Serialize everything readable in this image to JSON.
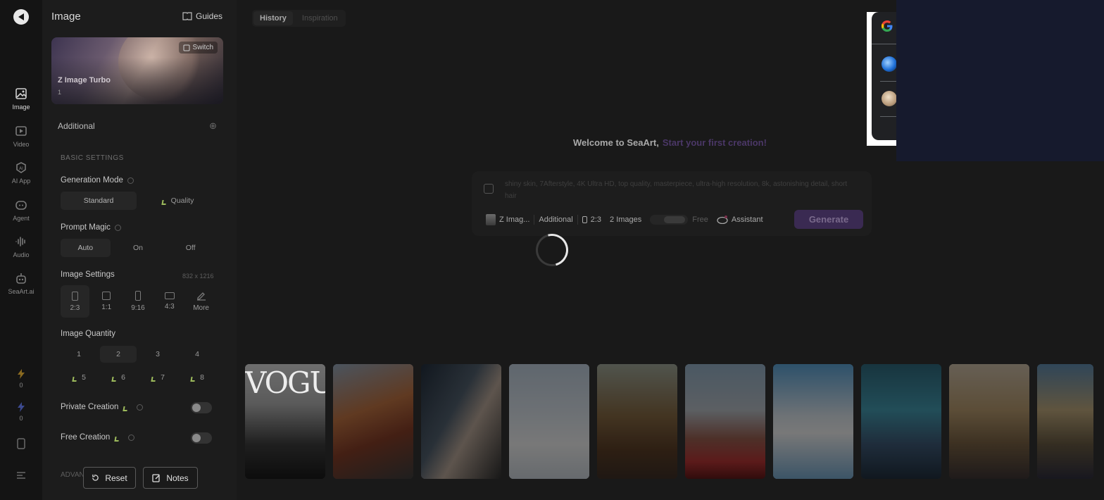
{
  "rail": {
    "items": [
      {
        "label": "Image",
        "icon": "image-icon"
      },
      {
        "label": "Video",
        "icon": "video-icon"
      },
      {
        "label": "AI App",
        "icon": "ai-app-icon"
      },
      {
        "label": "Agent",
        "icon": "agent-icon"
      },
      {
        "label": "Audio",
        "icon": "audio-icon"
      },
      {
        "label": "SeaArt.ai",
        "icon": "robot-icon"
      }
    ],
    "stats": [
      {
        "icon": "lightning-icon",
        "value": "0",
        "color": "#d4a72c"
      },
      {
        "icon": "lightning-icon",
        "value": "0",
        "color": "#5b6fd8"
      }
    ]
  },
  "panel": {
    "title": "Image",
    "guides_label": "Guides",
    "model": {
      "name": "Z Image Turbo",
      "sub": "1",
      "switch_label": "Switch"
    },
    "additional_label": "Additional",
    "basic_settings_label": "BASIC SETTINGS",
    "generation_mode": {
      "label": "Generation Mode",
      "options": [
        "Standard",
        "Quality"
      ],
      "selected": "Standard"
    },
    "prompt_magic": {
      "label": "Prompt Magic",
      "options": [
        "Auto",
        "On",
        "Off"
      ],
      "selected": "Auto"
    },
    "image_settings": {
      "label": "Image Settings",
      "size": "832 x 1216",
      "ratios": [
        "2:3",
        "1:1",
        "9:16",
        "4:3",
        "More"
      ],
      "selected": "2:3"
    },
    "image_quantity": {
      "label": "Image Quantity",
      "free": [
        "1",
        "2",
        "3",
        "4"
      ],
      "selected": "2",
      "vip": [
        "5",
        "6",
        "7",
        "8"
      ]
    },
    "private_creation_label": "Private Creation",
    "free_creation_label": "Free Creation",
    "advanced_label": "ADVANCED",
    "reset_label": "Reset",
    "notes_label": "Notes"
  },
  "main": {
    "tabs": [
      "History",
      "Inspiration"
    ],
    "selected_tab": "History",
    "welcome": "Welcome to SeaArt,",
    "welcome_accent": "Start your first creation!",
    "prompt_text": "shiny skin, 7Afterstyle, 4K Ultra HD, top quality, masterpiece, ultra-high resolution, 8k, astonishing detail, short hair",
    "toolbar": {
      "model": "Z Imag...",
      "additional": "Additional",
      "ratio": "2:3",
      "quantity": "2 Images",
      "free": "Free",
      "assistant": "Assistant",
      "generate": "Generate"
    },
    "gallery_vogue_text": "VOGU",
    "accent_color": "#6b3fb0"
  },
  "gallery": [
    {
      "name": "gallery-vogue-portrait"
    },
    {
      "name": "gallery-redhead-scarf"
    },
    {
      "name": "gallery-woman-closeup"
    },
    {
      "name": "gallery-skier-snow"
    },
    {
      "name": "gallery-steampunk-girl"
    },
    {
      "name": "gallery-red-car-landscape"
    },
    {
      "name": "gallery-cloud-girl"
    },
    {
      "name": "gallery-anime-catgirl"
    },
    {
      "name": "gallery-elf-warrior"
    },
    {
      "name": "gallery-fantasy-scene"
    }
  ]
}
